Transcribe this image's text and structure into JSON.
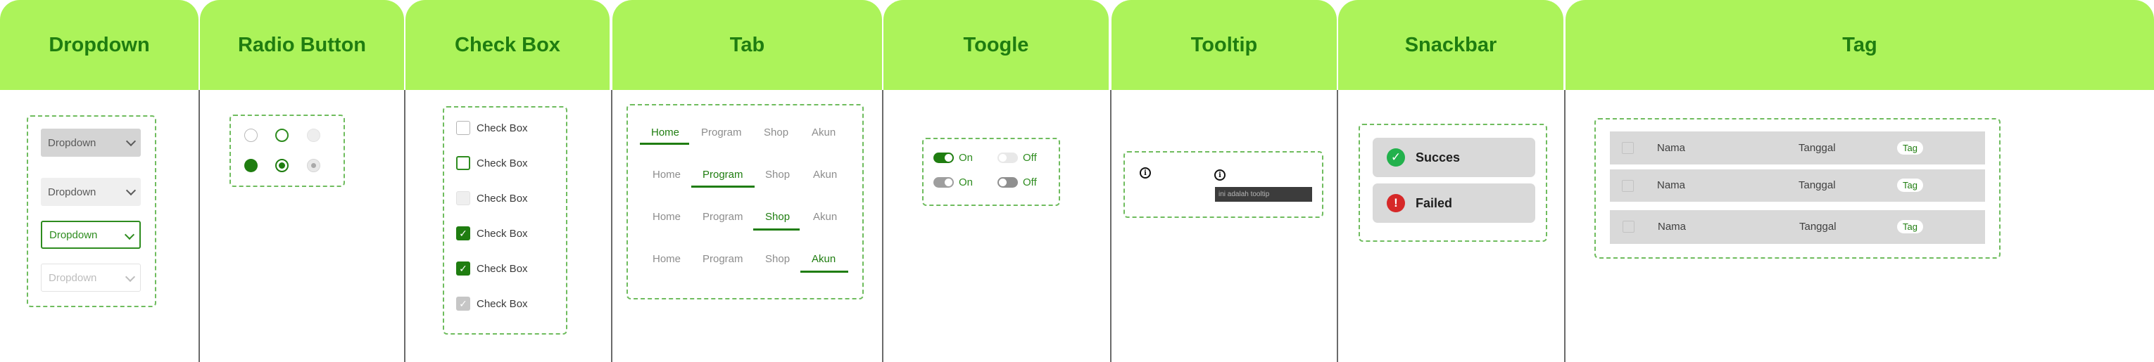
{
  "headers": {
    "dropdown": "Dropdown",
    "radio": "Radio Button",
    "checkbox": "Check Box",
    "tab": "Tab",
    "toggle": "Toogle",
    "tooltip": "Tooltip",
    "snackbar": "Snackbar",
    "tag": "Tag"
  },
  "dropdown": {
    "items": [
      {
        "label": "Dropdown",
        "state": "pressed"
      },
      {
        "label": "Dropdown",
        "state": "default"
      },
      {
        "label": "Dropdown",
        "state": "active"
      },
      {
        "label": "Dropdown",
        "state": "disabled"
      }
    ]
  },
  "checkbox": {
    "items": [
      {
        "label": "Check Box",
        "checked": false
      },
      {
        "label": "Check Box",
        "checked": false
      },
      {
        "label": "Check Box",
        "checked": false
      },
      {
        "label": "Check Box",
        "checked": true
      },
      {
        "label": "Check Box",
        "checked": true
      },
      {
        "label": "Check Box",
        "checked": true,
        "disabled": true
      }
    ]
  },
  "tabs": {
    "labels": [
      "Home",
      "Program",
      "Shop",
      "Akun"
    ],
    "active_per_row": [
      "Home",
      "Program",
      "Shop",
      "Akun"
    ]
  },
  "toggle": {
    "on_label": "On",
    "off_label": "Off"
  },
  "tooltip": {
    "icon_glyph": "i",
    "text": "ini adalah tooltip"
  },
  "snackbar": {
    "success": "Succes",
    "failed": "Failed"
  },
  "tag": {
    "rows": [
      {
        "name": "Nama",
        "date": "Tanggal",
        "tag": "Tag"
      },
      {
        "name": "Nama",
        "date": "Tanggal",
        "tag": "Tag"
      },
      {
        "name": "Nama",
        "date": "Tanggal",
        "tag": "Tag"
      }
    ]
  },
  "colors": {
    "header_bg": "#acf35a",
    "header_text": "#1f7d10",
    "accent": "#1f7d10",
    "success": "#22b14c",
    "error": "#d62828"
  },
  "icons": [
    "chevron-down-icon",
    "check-icon",
    "info-icon",
    "success-check-icon",
    "error-exclamation-icon"
  ]
}
